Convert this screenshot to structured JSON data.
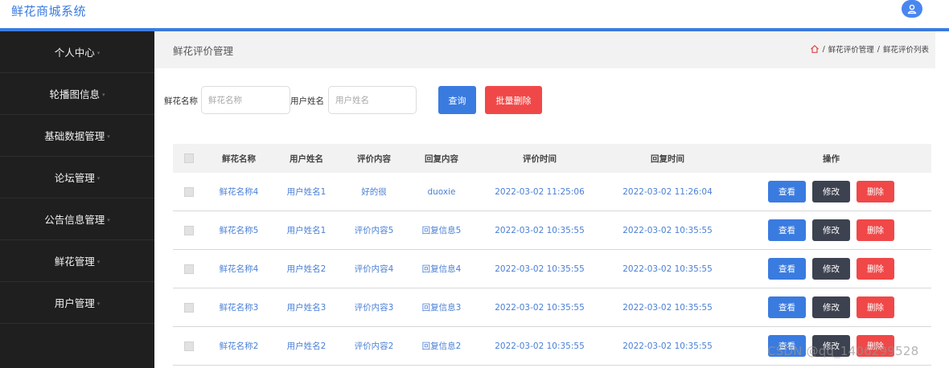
{
  "app": {
    "title": "鲜花商城系统"
  },
  "sidebar": {
    "items": [
      {
        "label": "个人中心"
      },
      {
        "label": "轮播图信息"
      },
      {
        "label": "基础数据管理"
      },
      {
        "label": "论坛管理"
      },
      {
        "label": "公告信息管理"
      },
      {
        "label": "鲜花管理"
      },
      {
        "label": "用户管理"
      }
    ],
    "caret": "▾"
  },
  "page": {
    "title": "鲜花评价管理"
  },
  "breadcrumb": {
    "level1": "鲜花评价管理",
    "sep": "/",
    "level2": "鲜花评价列表"
  },
  "search": {
    "flower_label": "鲜花名称",
    "flower_placeholder": "鲜花名称",
    "user_label": "用户姓名",
    "user_placeholder": "用户姓名",
    "query_button": "查询",
    "batch_delete_button": "批量删除"
  },
  "table": {
    "headers": [
      "鲜花名称",
      "用户姓名",
      "评价内容",
      "回复内容",
      "评价时间",
      "回复时间",
      "操作"
    ],
    "rows": [
      {
        "flower": "鲜花名称4",
        "user": "用户姓名1",
        "eval": "好的很",
        "reply": "duoxie",
        "eval_time": "2022-03-02 11:25:06",
        "reply_time": "2022-03-02 11:26:04"
      },
      {
        "flower": "鲜花名称5",
        "user": "用户姓名1",
        "eval": "评价内容5",
        "reply": "回复信息5",
        "eval_time": "2022-03-02 10:35:55",
        "reply_time": "2022-03-02 10:35:55"
      },
      {
        "flower": "鲜花名称4",
        "user": "用户姓名2",
        "eval": "评价内容4",
        "reply": "回复信息4",
        "eval_time": "2022-03-02 10:35:55",
        "reply_time": "2022-03-02 10:35:55"
      },
      {
        "flower": "鲜花名称3",
        "user": "用户姓名3",
        "eval": "评价内容3",
        "reply": "回复信息3",
        "eval_time": "2022-03-02 10:35:55",
        "reply_time": "2022-03-02 10:35:55"
      },
      {
        "flower": "鲜花名称2",
        "user": "用户姓名2",
        "eval": "评价内容2",
        "reply": "回复信息2",
        "eval_time": "2022-03-02 10:35:55",
        "reply_time": "2022-03-02 10:35:55"
      }
    ],
    "actions": {
      "view": "查看",
      "edit": "修改",
      "delete": "删除"
    }
  },
  "watermark": "CSDN @qq_1406299528",
  "colors": {
    "primary": "#3a7be0",
    "danger": "#f04848",
    "dark": "#3d4250",
    "sidebar": "#1f1f1f"
  }
}
